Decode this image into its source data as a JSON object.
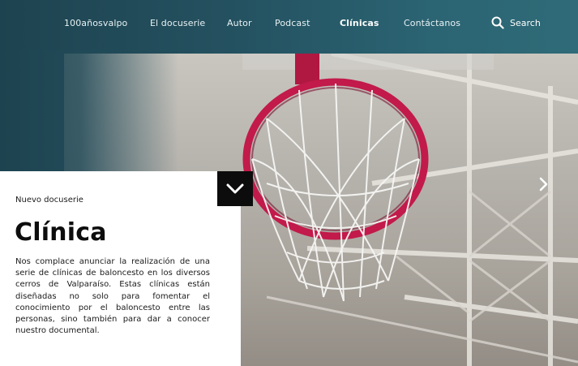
{
  "nav": {
    "items": [
      {
        "label": "100añosvalpo",
        "active": false
      },
      {
        "label": "El docuserie",
        "active": false
      },
      {
        "label": "Autor",
        "active": false
      },
      {
        "label": "Podcast",
        "active": false
      },
      {
        "label": "Clínicas",
        "active": true
      },
      {
        "label": "Contáctanos",
        "active": false
      }
    ],
    "search_label": "Search",
    "search_icon": "search-icon"
  },
  "hero": {
    "kicker": "Nuevo docuserie",
    "title": "Clínica",
    "body": "Nos complace anunciar la realización de una serie de clínicas de baloncesto en los diversos cerros de Valparaíso. Estas clínicas están diseñadas no solo para fomentar el conocimiento por el baloncesto entre las personas, sino también para dar a conocer nuestro documental.",
    "scroll_icon": "chevron-down-icon",
    "next_icon": "chevron-right-icon"
  },
  "colors": {
    "nav_bg": "#245160",
    "rim": "#c21a4a",
    "card_bg": "#ffffff",
    "button_bg": "#0c0c0c"
  }
}
